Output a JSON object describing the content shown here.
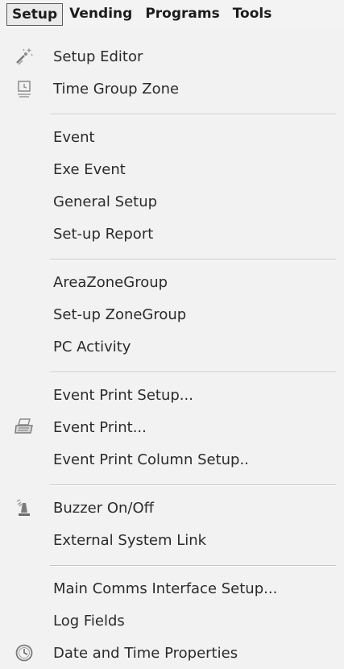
{
  "menubar": {
    "items": [
      "Setup",
      "Vending",
      "Programs",
      "Tools"
    ],
    "active": "Setup"
  },
  "menu": {
    "items": [
      {
        "label": "Setup Editor",
        "icon": "setup-editor-icon"
      },
      {
        "label": "Time Group Zone",
        "icon": "time-group-zone-icon"
      },
      {
        "label": "Event"
      },
      {
        "label": "Exe Event"
      },
      {
        "label": "General Setup"
      },
      {
        "label": "Set-up Report"
      },
      {
        "label": "AreaZoneGroup"
      },
      {
        "label": "Set-up ZoneGroup"
      },
      {
        "label": "PC Activity"
      },
      {
        "label": "Event Print Setup..."
      },
      {
        "label": "Event Print...",
        "icon": "printer-icon"
      },
      {
        "label": "Event Print Column Setup.."
      },
      {
        "label": "Buzzer On/Off",
        "icon": "buzzer-icon"
      },
      {
        "label": "External System Link"
      },
      {
        "label": "Main Comms Interface Setup..."
      },
      {
        "label": "Log Fields"
      },
      {
        "label": "Date and Time Properties",
        "icon": "clock-icon"
      }
    ]
  }
}
